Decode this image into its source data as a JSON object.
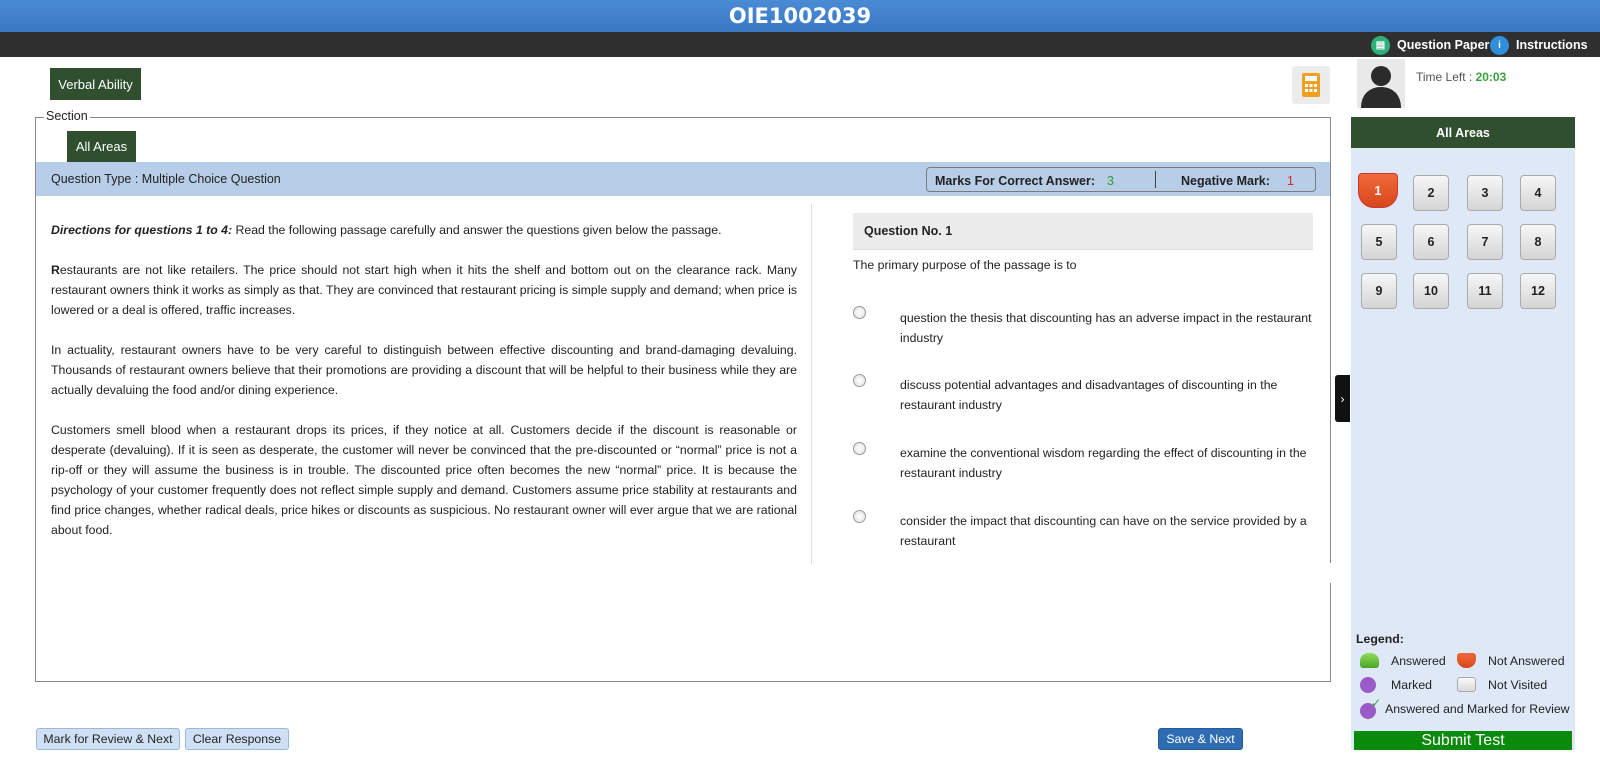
{
  "header": {
    "title": "OIE1002039"
  },
  "toplinks": {
    "question_paper": "Question Paper",
    "instructions": "Instructions"
  },
  "section_tab": "Verbal Ability",
  "section_label": "Section",
  "area_tab": "All Areas",
  "question_type": "Question Type : Multiple Choice Question",
  "marks": {
    "correct_label": "Marks For Correct Answer:",
    "correct_value": "3",
    "negative_label": "Negative Mark:",
    "negative_value": "1"
  },
  "passage": {
    "directions_label": "Directions for questions 1 to 4:",
    "directions_text": " Read the following passage carefully and answer the questions given below the passage.",
    "p1_first": "R",
    "p1_rest": "estaurants are not like retailers. The price should not start high when it hits the shelf and bottom out on the clearance rack. Many restaurant owners think it works as simply as that. They are convinced that restaurant pricing is simple supply and demand; when price is lowered or a deal is offered, traffic increases.",
    "p2": "In actuality, restaurant owners have to be very careful to distinguish between effective discounting and brand-damaging devaluing. Thousands of restaurant owners believe that their promotions are providing a discount that will be helpful to their business while they are actually devaluing the food and/or dining experience.",
    "p3": "Customers smell blood when a restaurant drops its prices, if they notice at all. Customers decide if the discount is reasonable or desperate (devaluing). If it is seen as desperate, the customer will never be convinced that the pre-discounted or “normal” price is not a rip-off or they will assume the business is in trouble. The discounted price often becomes the new “normal” price. It is because the psychology of your customer frequently does not reflect simple supply and demand. Customers assume price stability at restaurants and find price changes, whether radical deals, price hikes or discounts as suspicious. No restaurant owner will ever argue that we are rational about food."
  },
  "question": {
    "number_label": "Question No. 1",
    "text": "The primary purpose of the passage is to",
    "options": [
      "question the thesis that discounting has an adverse impact in the restaurant industry",
      "discuss potential advantages and disadvantages of discounting in the restaurant industry",
      "examine the conventional wisdom regarding the effect of discounting in the restaurant industry",
      "consider the impact that discounting can have on the service provided by a restaurant"
    ]
  },
  "profile": {
    "time_label": "Time Left : ",
    "time_value": "20:03"
  },
  "palette": {
    "title": "All Areas",
    "numbers": [
      "1",
      "2",
      "3",
      "4",
      "5",
      "6",
      "7",
      "8",
      "9",
      "10",
      "11",
      "12"
    ]
  },
  "legend": {
    "title": "Legend:",
    "answered": "Answered",
    "not_answered": "Not Answered",
    "marked": "Marked",
    "not_visited": "Not Visited",
    "answered_marked": "Answered and Marked for Review"
  },
  "buttons": {
    "mark_review": "Mark for Review & Next",
    "clear": "Clear Response",
    "save_next": "Save & Next",
    "submit": "Submit Test"
  },
  "colors": {
    "accent_blue": "#3a78c4",
    "dark_green": "#2f4f2f",
    "not_answered": "#d8461d",
    "submit_green": "#0a8a0a"
  }
}
